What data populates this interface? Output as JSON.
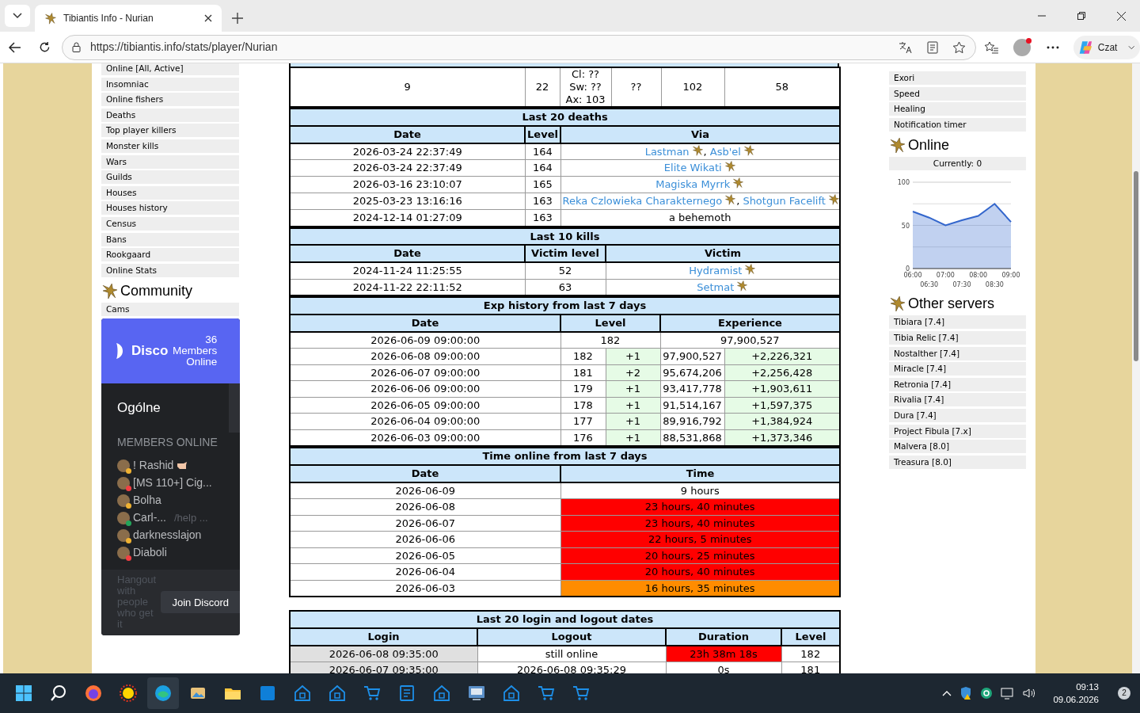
{
  "browser": {
    "tab_title": "Tibiantis Info - Nurian",
    "url": "https://tibiantis.info/stats/player/Nurian",
    "chat_label": "Czat"
  },
  "left_menu": {
    "items": [
      "Online [All, Active]",
      "Insomniac",
      "Online fishers",
      "Deaths",
      "Top player killers",
      "Monster kills",
      "Wars",
      "Guilds",
      "Houses",
      "Houses history",
      "Census",
      "Bans",
      "Rookgaard",
      "Online Stats"
    ],
    "community_title": "Community",
    "community_items": [
      "Cams"
    ]
  },
  "discord": {
    "count": "36",
    "brand": "Disco",
    "members_label": "Members Online",
    "channel": "Ogólne",
    "members_heading": "MEMBERS ONLINE",
    "members": [
      {
        "name": "! Rashid",
        "color": "#f0b232",
        "hand": true
      },
      {
        "name": "[MS 110+] Cig...",
        "color": "#f23f43"
      },
      {
        "name": "Bolha",
        "color": "#f0b232"
      },
      {
        "name": "Carl-...",
        "activity": "/help ...",
        "color": "#23a55a"
      },
      {
        "name": "darknesslajon",
        "color": "#f0b232"
      },
      {
        "name": "Diaboli",
        "color": "#f23f43"
      }
    ],
    "footer_text": "Hangout with people who get it",
    "join_button": "Join Discord"
  },
  "stats_row": {
    "cells": [
      [
        "9"
      ],
      [
        "22"
      ],
      [
        "Cl: ??",
        "Sw: ??",
        "Ax: 103"
      ],
      [
        "??"
      ],
      [
        "102"
      ],
      [
        "58"
      ]
    ]
  },
  "deaths": {
    "title": "Last 20 deaths",
    "columns": [
      "Date",
      "Level",
      "Via"
    ],
    "rows": [
      {
        "date": "2026-03-24 22:37:49",
        "level": "164",
        "via": [
          {
            "name": "Lastman",
            "kind": "player",
            "separator": ","
          },
          {
            "name": "Asb'el",
            "kind": "player"
          }
        ]
      },
      {
        "date": "2026-03-24 22:37:49",
        "level": "164",
        "via": [
          {
            "name": "Elite Wikati",
            "kind": "player"
          }
        ]
      },
      {
        "date": "2026-03-16 23:10:07",
        "level": "165",
        "via": [
          {
            "name": "Magiska Myrrk",
            "kind": "player"
          }
        ]
      },
      {
        "date": "2025-03-23 13:16:16",
        "level": "163",
        "via": [
          {
            "name": "Reka Czlowieka Charakternego",
            "kind": "player",
            "separator": ","
          },
          {
            "name": "Shotgun Facelift",
            "kind": "player"
          }
        ]
      },
      {
        "date": "2024-12-14 01:27:09",
        "level": "163",
        "via": [
          {
            "name": "a behemoth",
            "kind": "monster"
          }
        ]
      }
    ]
  },
  "kills": {
    "title": "Last 10 kills",
    "columns": [
      "Date",
      "Victim level",
      "Victim"
    ],
    "rows": [
      {
        "date": "2024-11-24 11:25:55",
        "level": "52",
        "victim": "Hydramist"
      },
      {
        "date": "2024-11-22 22:11:52",
        "level": "63",
        "victim": "Setmat"
      }
    ]
  },
  "exp_history": {
    "title": "Exp history from last 7 days",
    "columns": [
      "Date",
      "Level",
      "Experience"
    ],
    "rows": [
      {
        "date": "2026-06-09 09:00:00",
        "kind": "summary",
        "level_summary": "182",
        "experience_summary": "97,900,527"
      },
      {
        "date": "2026-06-08 09:00:00",
        "level": "182",
        "level_gain": "+1",
        "experience": "97,900,527",
        "exp_gain": "+2,226,321"
      },
      {
        "date": "2026-06-07 09:00:00",
        "level": "181",
        "level_gain": "+2",
        "experience": "95,674,206",
        "exp_gain": "+2,256,428"
      },
      {
        "date": "2026-06-06 09:00:00",
        "level": "179",
        "level_gain": "+1",
        "experience": "93,417,778",
        "exp_gain": "+1,903,611"
      },
      {
        "date": "2026-06-05 09:00:00",
        "level": "178",
        "level_gain": "+1",
        "experience": "91,514,167",
        "exp_gain": "+1,597,375"
      },
      {
        "date": "2026-06-04 09:00:00",
        "level": "177",
        "level_gain": "+1",
        "experience": "89,916,792",
        "exp_gain": "+1,384,924"
      },
      {
        "date": "2026-06-03 09:00:00",
        "level": "176",
        "level_gain": "+1",
        "experience": "88,531,868",
        "exp_gain": "+1,373,346"
      }
    ]
  },
  "time_online": {
    "title": "Time online from last 7 days",
    "columns": [
      "Date",
      "Time"
    ],
    "rows": [
      {
        "date": "2026-06-09",
        "time": "9 hours",
        "color": "#ffffff"
      },
      {
        "date": "2026-06-08",
        "time": "23 hours, 40 minutes",
        "color": "#ff0000"
      },
      {
        "date": "2026-06-07",
        "time": "23 hours, 40 minutes",
        "color": "#ff0000"
      },
      {
        "date": "2026-06-06",
        "time": "22 hours, 5 minutes",
        "color": "#ff0000"
      },
      {
        "date": "2026-06-05",
        "time": "20 hours, 25 minutes",
        "color": "#ff0000"
      },
      {
        "date": "2026-06-04",
        "time": "20 hours, 40 minutes",
        "color": "#ff0000"
      },
      {
        "date": "2026-06-03",
        "time": "16 hours, 35 minutes",
        "color": "#ff8c00"
      }
    ]
  },
  "logins": {
    "title": "Last 20 login and logout dates",
    "columns": [
      "Login",
      "Logout",
      "Duration",
      "Level"
    ],
    "rows": [
      {
        "login": "2026-06-08 09:35:00",
        "logout": "still online",
        "duration": "23h 38m 18s",
        "color": "#ff0000",
        "level": "182"
      },
      {
        "login": "2026-06-07 09:35:00",
        "logout": "2026-06-08 09:35:29",
        "duration": "0s",
        "color": "#ffffff",
        "level": "181"
      }
    ]
  },
  "right_menu": {
    "items": [
      "Exori",
      "Speed",
      "Healing",
      "Notification timer"
    ],
    "online_title": "Online",
    "currently": "Currently: 0",
    "chart_data": {
      "type": "area",
      "x": [
        "06:00",
        "06:30",
        "07:00",
        "07:30",
        "08:00",
        "08:30",
        "09:00"
      ],
      "series": [
        {
          "color": "#3366cc",
          "values": [
            66,
            59,
            50,
            56,
            61,
            75,
            54
          ]
        }
      ],
      "ylim": [
        0,
        100
      ],
      "yticks": [
        0,
        50,
        100
      ]
    },
    "servers_title": "Other servers",
    "servers": [
      "Tibiara [7.4]",
      "Tibia Relic [7.4]",
      "Nostalther [7.4]",
      "Miracle [7.4]",
      "Retronia [7.4]",
      "Rivalia [7.4]",
      "Dura [7.4]",
      "Project Fibula [7.x]",
      "Malvera [8.0]",
      "Treasura [8.0]"
    ]
  },
  "taskbar": {
    "time": "09:13",
    "date": "09.06.2026",
    "notifications": "2"
  }
}
